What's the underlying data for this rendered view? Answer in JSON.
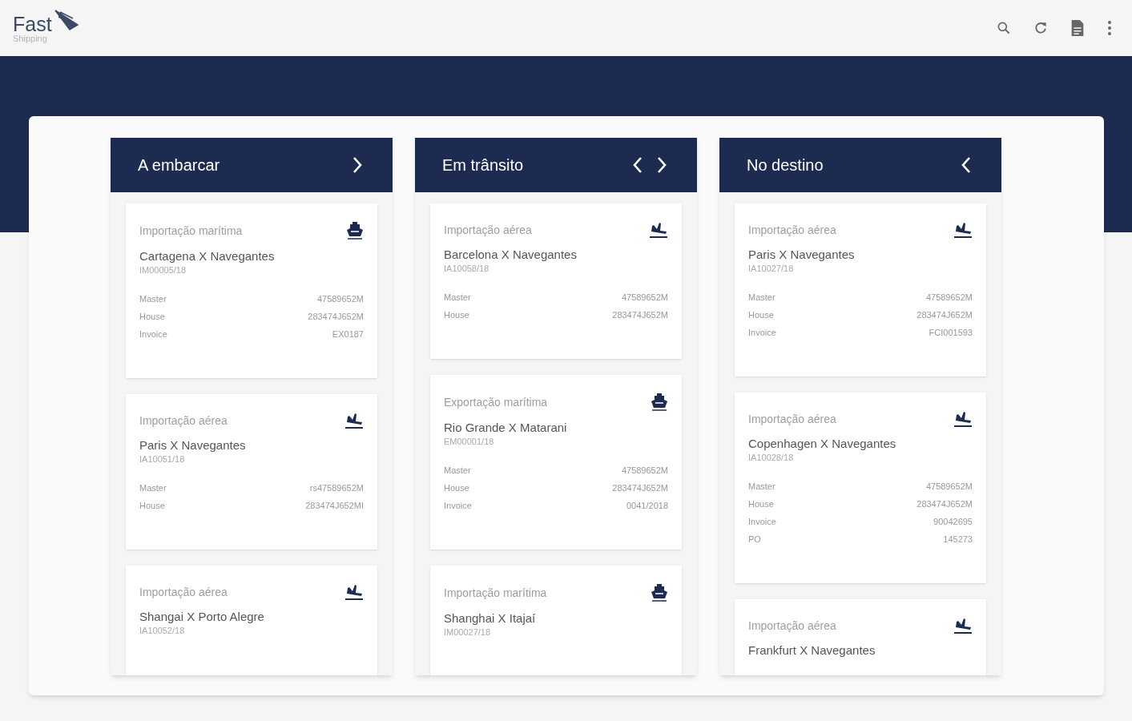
{
  "header": {
    "logo": {
      "name": "Fast",
      "tagline": "Shipping"
    }
  },
  "columns": [
    {
      "title": "A embarcar",
      "has_prev": false,
      "has_next": true,
      "cards": [
        {
          "kind": "sea",
          "type": "Importação marítima",
          "route": "Cartagena X Navegantes",
          "code": "IM00005/18",
          "fields": [
            {
              "label": "Master",
              "value": "47589652M"
            },
            {
              "label": "House",
              "value": "283474J652M"
            },
            {
              "label": "Invoice",
              "value": "EX0187"
            }
          ]
        },
        {
          "kind": "air",
          "type": "Importação aérea",
          "route": "Paris X Navegantes",
          "code": "IA10051/18",
          "fields": [
            {
              "label": "Master",
              "value": "rs47589652M"
            },
            {
              "label": "House",
              "value": "283474J652MI"
            }
          ]
        },
        {
          "kind": "air",
          "type": "Importação aérea",
          "route": "Shangai X Porto Alegre",
          "code": "IA10052/18"
        }
      ]
    },
    {
      "title": "Em trânsito",
      "has_prev": true,
      "has_next": true,
      "cards": [
        {
          "kind": "air",
          "type": "Importação aérea",
          "route": "Barcelona X Navegantes",
          "code": "IA10058/18",
          "fields": [
            {
              "label": "Master",
              "value": "47589652M"
            },
            {
              "label": "House",
              "value": "283474J652M"
            }
          ]
        },
        {
          "kind": "sea",
          "type": "Exportação marítima",
          "route": "Rio Grande X Matarani",
          "code": "EM00001/18",
          "fields": [
            {
              "label": "Master",
              "value": "47589652M"
            },
            {
              "label": "House",
              "value": "283474J652M"
            },
            {
              "label": "Invoice",
              "value": "0041/2018"
            }
          ]
        },
        {
          "kind": "sea",
          "type": "Importação marítima",
          "route": "Shanghai X Itajaí",
          "code": "IM00027/18"
        }
      ]
    },
    {
      "title": "No destino",
      "has_prev": true,
      "has_next": false,
      "cards": [
        {
          "kind": "air",
          "type": "Importação aérea",
          "route": "Paris X Navegantes",
          "code": "IA10027/18",
          "fields": [
            {
              "label": "Master",
              "value": "47589652M"
            },
            {
              "label": "House",
              "value": "283474J652M"
            },
            {
              "label": "Invoice",
              "value": "FCI001593"
            }
          ]
        },
        {
          "kind": "air",
          "type": "Importação aérea",
          "route": "Copenhagen X Navegantes",
          "code": "IA10028/18",
          "fields": [
            {
              "label": "Master",
              "value": "47589652M"
            },
            {
              "label": "House",
              "value": "283474J652M"
            },
            {
              "label": "Invoice",
              "value": "90042695"
            },
            {
              "label": "PO",
              "value": "145273"
            }
          ]
        },
        {
          "kind": "air",
          "type": "Importação aérea",
          "route": "Frankfurt X Navegantes"
        }
      ]
    }
  ]
}
